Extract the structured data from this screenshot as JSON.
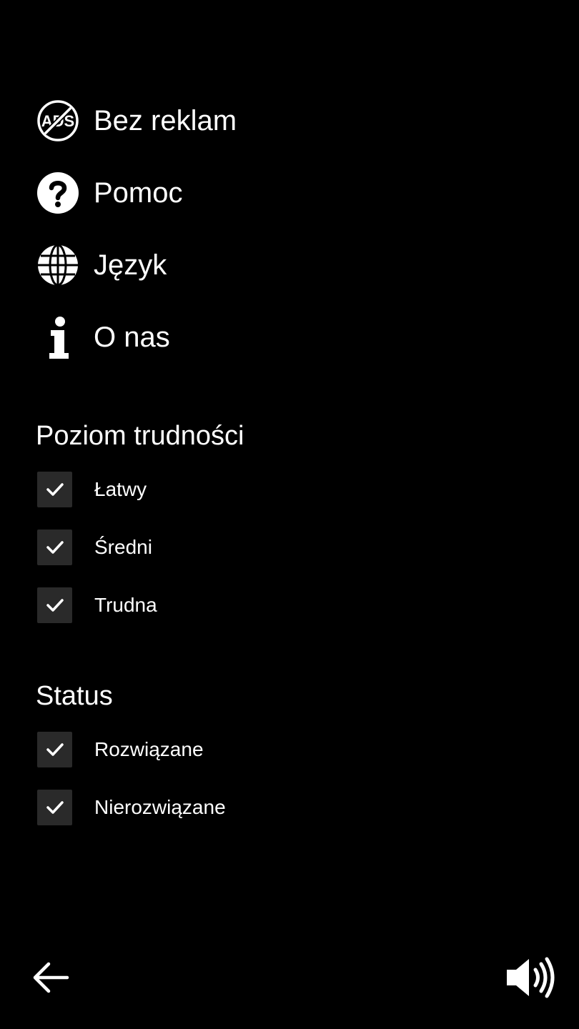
{
  "menu": {
    "items": [
      {
        "label": "Bez reklam",
        "icon": "no-ads-icon"
      },
      {
        "label": "Pomoc",
        "icon": "help-icon"
      },
      {
        "label": "Język",
        "icon": "globe-icon"
      },
      {
        "label": "O nas",
        "icon": "info-icon"
      }
    ]
  },
  "difficulty": {
    "title": "Poziom trudności",
    "options": [
      {
        "label": "Łatwy",
        "checked": true
      },
      {
        "label": "Średni",
        "checked": true
      },
      {
        "label": "Trudna",
        "checked": true
      }
    ]
  },
  "status": {
    "title": "Status",
    "options": [
      {
        "label": "Rozwiązane",
        "checked": true
      },
      {
        "label": "Nierozwiązane",
        "checked": true
      }
    ]
  },
  "footer": {
    "back_icon": "arrow-left-icon",
    "sound_icon": "volume-icon"
  },
  "colors": {
    "background": "#000000",
    "text": "#ffffff",
    "checkbox_fill": "#2a2a2a"
  }
}
